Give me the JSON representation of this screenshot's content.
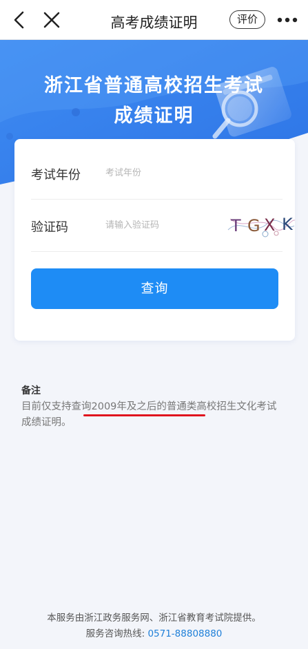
{
  "header": {
    "title": "高考成绩证明",
    "rate_label": "评价"
  },
  "hero": {
    "line1": "浙江省普通高校招生考试",
    "line2": "成绩证明"
  },
  "form": {
    "year_label": "考试年份",
    "year_placeholder": "考试年份",
    "captcha_label": "验证码",
    "captcha_placeholder": "请输入验证码",
    "captcha_letters": [
      "T",
      "G",
      "X",
      "K"
    ],
    "submit_label": "查询"
  },
  "note": {
    "title": "备注",
    "text": "目前仅支持查询2009年及之后的普通类高校招生文化考试成绩证明。"
  },
  "footer": {
    "provider": "本服务由浙江政务服务网、浙江省教育考试院提供。",
    "hotline_label": "服务咨询热线:",
    "hotline_number": "0571-88808880"
  },
  "colors": {
    "accent": "#1e8cf5",
    "hero_blue": "#3a86f0",
    "annotation_red": "#e0141e"
  }
}
